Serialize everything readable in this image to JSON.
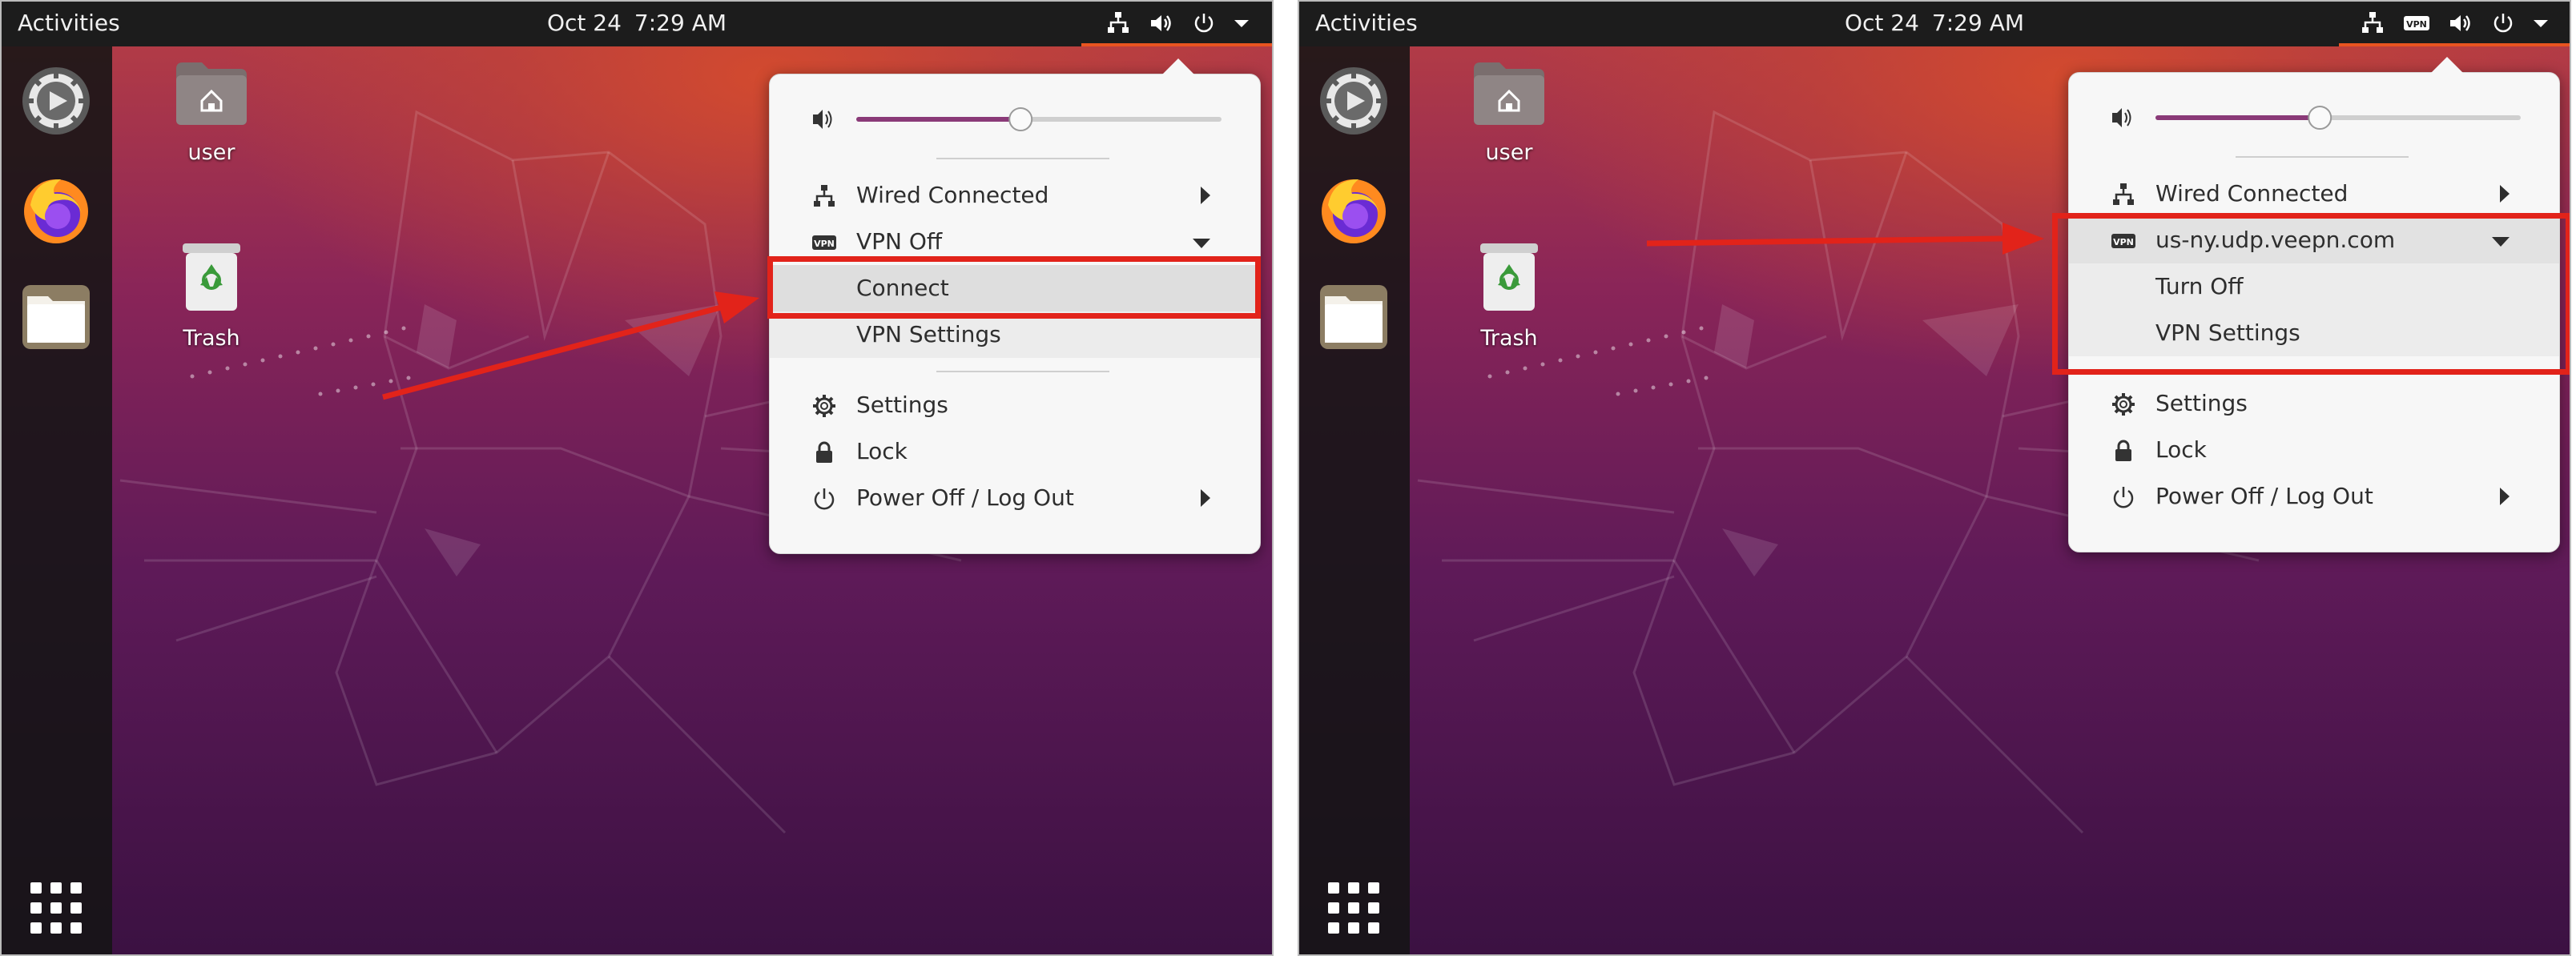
{
  "colors": {
    "accent": "#e95420",
    "annotation_red": "#e2231a",
    "menu_bg": "#f7f7f7",
    "topbar": "#1c1c1c",
    "slider_fill": "#8a3a78"
  },
  "left": {
    "topbar": {
      "activities": "Activities",
      "date": "Oct 24",
      "time": "7:29 AM"
    },
    "tray_icons": [
      "network-icon",
      "volume-icon",
      "power-icon",
      "chevron-down-icon"
    ],
    "desktop": {
      "home_label": "user",
      "trash_label": "Trash"
    },
    "dock": [
      "settings-icon",
      "firefox-icon",
      "files-icon",
      "app-grid-icon"
    ],
    "menu": {
      "volume_percent": 45,
      "wired": "Wired Connected",
      "vpn": "VPN Off",
      "connect": "Connect",
      "vpn_settings": "VPN Settings",
      "settings": "Settings",
      "lock": "Lock",
      "power": "Power Off / Log Out"
    }
  },
  "right": {
    "topbar": {
      "activities": "Activities",
      "date": "Oct 24",
      "time": "7:29 AM"
    },
    "tray_icons": [
      "network-icon",
      "vpn-icon",
      "volume-icon",
      "power-icon",
      "chevron-down-icon"
    ],
    "desktop": {
      "home_label": "user",
      "trash_label": "Trash"
    },
    "dock": [
      "settings-icon",
      "firefox-icon",
      "files-icon",
      "app-grid-icon"
    ],
    "menu": {
      "volume_percent": 45,
      "wired": "Wired Connected",
      "vpn": "us-ny.udp.veepn.com",
      "turn_off": "Turn Off",
      "vpn_settings": "VPN Settings",
      "settings": "Settings",
      "lock": "Lock",
      "power": "Power Off / Log Out"
    }
  },
  "vpn_badge": "VPN"
}
